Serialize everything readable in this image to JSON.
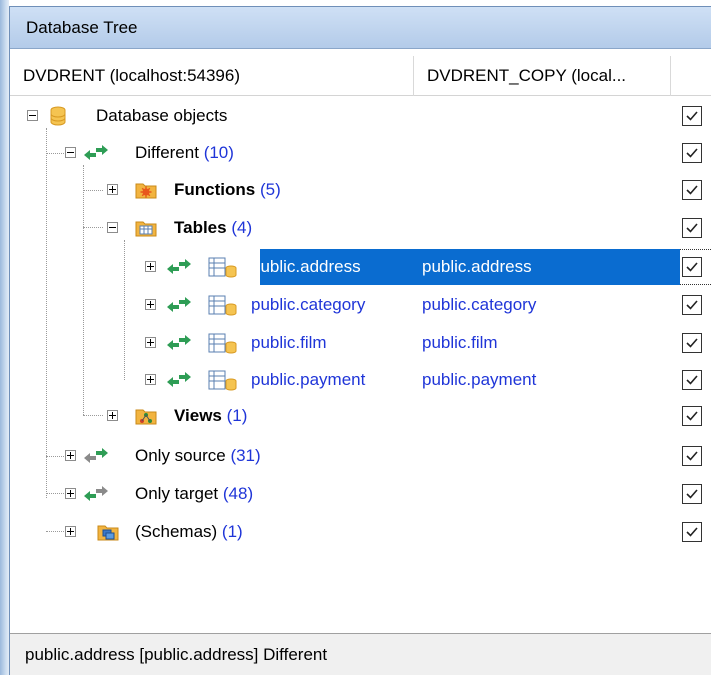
{
  "panel": {
    "title": "Database Tree"
  },
  "columns": {
    "source": "DVDRENT (localhost:54396)",
    "target": "DVDRENT_COPY (local..."
  },
  "tree": {
    "root": {
      "label": "Database objects",
      "checked": true,
      "icon": "database-icon"
    },
    "different": {
      "label": "Different",
      "count": "(10)",
      "checked": true,
      "icon": "bidirectional-arrow-icon"
    },
    "functions": {
      "label": "Functions",
      "count": "(5)",
      "checked": true,
      "icon": "functions-folder-icon"
    },
    "tables": {
      "label": "Tables",
      "count": "(4)",
      "checked": true,
      "icon": "tables-folder-icon"
    },
    "table_rows": [
      {
        "source": "public.address",
        "target": "public.address",
        "checked": true,
        "selected": true
      },
      {
        "source": "public.category",
        "target": "public.category",
        "checked": true
      },
      {
        "source": "public.film",
        "target": "public.film",
        "checked": true
      },
      {
        "source": "public.payment",
        "target": "public.payment",
        "checked": true
      }
    ],
    "views": {
      "label": "Views",
      "count": "(1)",
      "checked": true,
      "icon": "views-folder-icon"
    },
    "only_source": {
      "label": "Only source",
      "count": "(31)",
      "checked": true,
      "icon": "right-arrow-icon"
    },
    "only_target": {
      "label": "Only target",
      "count": "(48)",
      "checked": true,
      "icon": "left-arrow-icon"
    },
    "schemas": {
      "label": "(Schemas)",
      "count": "(1)",
      "checked": true,
      "icon": "schemas-folder-icon"
    }
  },
  "status": {
    "text": "public.address [public.address] Different"
  },
  "colors": {
    "selection": "#0a6cd0",
    "count_blue": "#1f35d8",
    "arrow_green": "#2e9d55",
    "folder_orange": "#f2b440"
  }
}
